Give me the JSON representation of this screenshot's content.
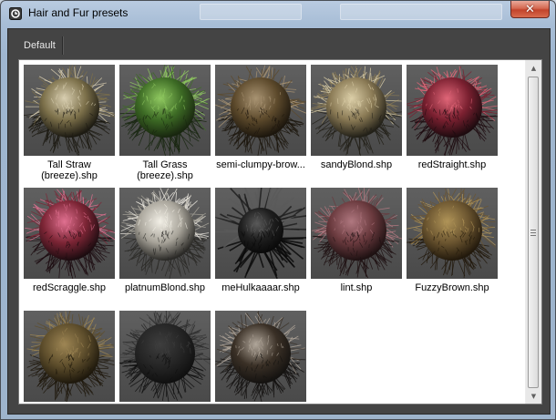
{
  "window": {
    "title": "Hair and Fur presets",
    "close_symbol": "✕"
  },
  "tabs": [
    {
      "label": "Default",
      "selected": true
    }
  ],
  "presets": [
    {
      "label": "Tall Straw (breeze).shp",
      "lines": [
        "Tall Straw",
        "(breeze).shp"
      ],
      "thumb": {
        "base": "#7c704a",
        "tip": "#d8ceb0",
        "dark": "#1c1a12",
        "spiky": false
      }
    },
    {
      "label": "Tall Grass (breeze).shp",
      "lines": [
        "Tall Grass",
        "(breeze).shp"
      ],
      "thumb": {
        "base": "#3d6b25",
        "tip": "#8fc860",
        "dark": "#18260f",
        "spiky": false
      }
    },
    {
      "label": "semi-clumpy-brow...",
      "lines": [
        "semi-clumpy-brow..."
      ],
      "thumb": {
        "base": "#5d4a2c",
        "tip": "#a89372",
        "dark": "#1c160d",
        "spiky": false
      }
    },
    {
      "label": "sandyBlond.shp",
      "lines": [
        "sandyBlond.shp"
      ],
      "thumb": {
        "base": "#8a7a55",
        "tip": "#dccfa8",
        "dark": "#222018",
        "spiky": false
      }
    },
    {
      "label": "redStraight.shp",
      "lines": [
        "redStraight.shp"
      ],
      "thumb": {
        "base": "#7a2030",
        "tip": "#e06678",
        "dark": "#1d0b0f",
        "spiky": false
      }
    },
    {
      "label": "redScraggle.shp",
      "lines": [
        "redScraggle.shp"
      ],
      "thumb": {
        "base": "#7c2535",
        "tip": "#e07090",
        "dark": "#1c0c10",
        "spiky": false
      }
    },
    {
      "label": "platnumBlond.shp",
      "lines": [
        "platnumBlond.shp"
      ],
      "thumb": {
        "base": "#a8a49a",
        "tip": "#f2efe6",
        "dark": "#2a2926",
        "spiky": false
      }
    },
    {
      "label": "meHulkaaaar.shp",
      "lines": [
        "meHulkaaaar.shp"
      ],
      "thumb": {
        "base": "#1e1e1e",
        "tip": "#5a5a5a",
        "dark": "#0a0a0a",
        "spiky": true
      }
    },
    {
      "label": "lint.shp",
      "lines": [
        "lint.shp"
      ],
      "thumb": {
        "base": "#6a3a3e",
        "tip": "#b07880",
        "dark": "#1e1112",
        "spiky": false
      }
    },
    {
      "label": "FuzzyBrown.shp",
      "lines": [
        "FuzzyBrown.shp"
      ],
      "thumb": {
        "base": "#6b5530",
        "tip": "#b09458",
        "dark": "#22190c",
        "spiky": false
      }
    },
    {
      "label": "",
      "lines": [],
      "thumb": {
        "base": "#5e4e2c",
        "tip": "#9e8654",
        "dark": "#1e180c",
        "spiky": false
      }
    },
    {
      "label": "",
      "lines": [],
      "thumb": {
        "base": "#262626",
        "tip": "#3e3e3e",
        "dark": "#101010",
        "spiky": false
      }
    },
    {
      "label": "",
      "lines": [],
      "thumb": {
        "base": "#3a3026",
        "tip": "#b0a69a",
        "dark": "#141210",
        "spiky": false
      }
    }
  ],
  "scrollbar": {
    "up_symbol": "▲",
    "down_symbol": "▼"
  }
}
